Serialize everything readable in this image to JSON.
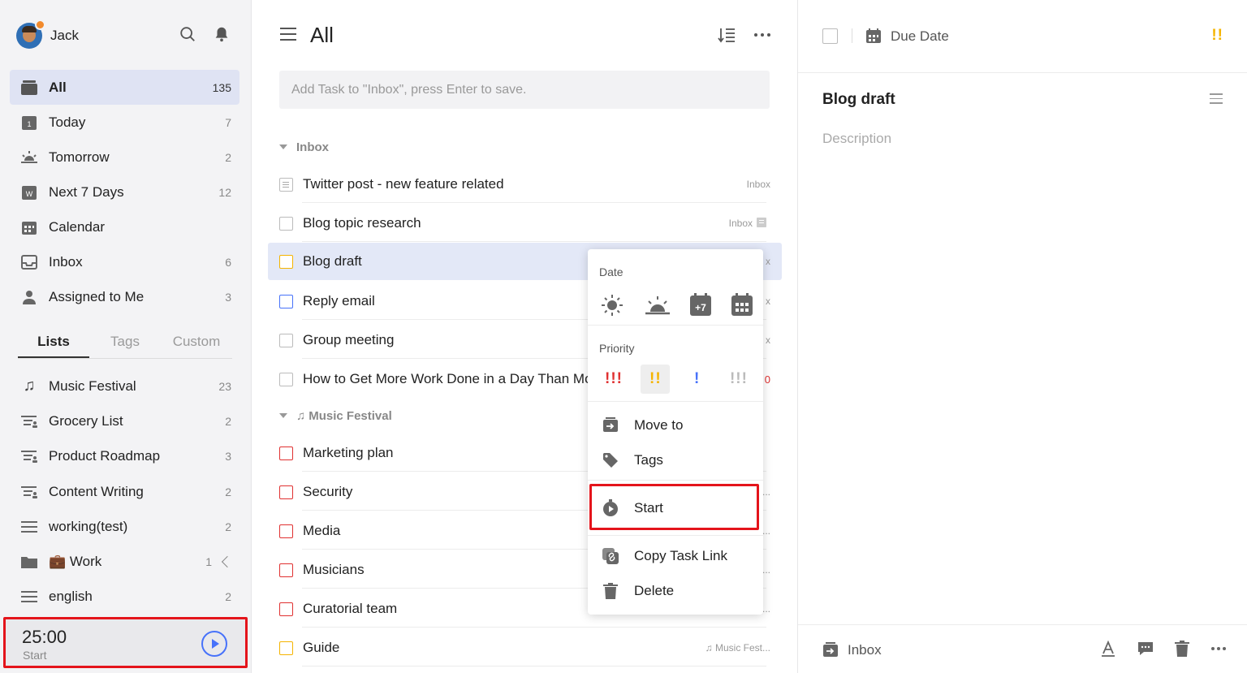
{
  "user": {
    "name": "Jack"
  },
  "nav": [
    {
      "label": "All",
      "count": "135",
      "icon": "inbox-stack-icon",
      "active": true
    },
    {
      "label": "Today",
      "count": "7",
      "icon": "calendar-day-icon"
    },
    {
      "label": "Tomorrow",
      "count": "2",
      "icon": "sunrise-icon"
    },
    {
      "label": "Next 7 Days",
      "count": "12",
      "icon": "calendar-week-icon"
    },
    {
      "label": "Calendar",
      "count": "",
      "icon": "calendar-icon"
    },
    {
      "label": "Inbox",
      "count": "6",
      "icon": "inbox-icon"
    },
    {
      "label": "Assigned to Me",
      "count": "3",
      "icon": "person-icon"
    }
  ],
  "tabs": {
    "lists": "Lists",
    "tags": "Tags",
    "custom": "Custom"
  },
  "lists": [
    {
      "label": "Music Festival",
      "count": "23",
      "icon": "music-note-icon"
    },
    {
      "label": "Grocery List",
      "count": "2",
      "icon": "shared-list-icon"
    },
    {
      "label": "Product Roadmap",
      "count": "3",
      "icon": "shared-list-icon"
    },
    {
      "label": "Content Writing",
      "count": "2",
      "icon": "shared-list-icon"
    },
    {
      "label": "working(test)",
      "count": "2",
      "icon": "list-icon"
    },
    {
      "label": "💼 Work",
      "count": "1",
      "icon": "folder-icon"
    },
    {
      "label": "english",
      "count": "2",
      "icon": "list-icon"
    }
  ],
  "timer": {
    "time": "25:00",
    "label": "Start"
  },
  "main": {
    "title": "All",
    "add_placeholder": "Add Task to \"Inbox\", press Enter to save.",
    "section_inbox": "Inbox",
    "section_music": "Music Festival",
    "tasks": [
      {
        "title": "Twitter post - new feature related",
        "tag": "Inbox"
      },
      {
        "title": "Blog topic research",
        "tag": "Inbox"
      },
      {
        "title": "Blog draft",
        "tag": "x"
      },
      {
        "title": "Reply email",
        "tag": "x"
      },
      {
        "title": "Group meeting",
        "tag": "x"
      },
      {
        "title": "How to Get More Work Done in a Day Than Mo",
        "tag": "0"
      },
      {
        "title": "Marketing plan",
        "tag": ""
      },
      {
        "title": "Security",
        "tag": "..."
      },
      {
        "title": "Media",
        "tag": "..."
      },
      {
        "title": "Musicians",
        "tag": "..."
      },
      {
        "title": "Curatorial team",
        "tag": "..."
      },
      {
        "title": "Guide",
        "tag": "♫ Music Fest..."
      }
    ]
  },
  "menu": {
    "date_label": "Date",
    "priority_label": "Priority",
    "priority_high": "!!!",
    "priority_medium": "!!",
    "priority_low": "!",
    "priority_none": "!!!",
    "move_to": "Move to",
    "tags": "Tags",
    "start": "Start",
    "copy_link": "Copy Task Link",
    "delete": "Delete"
  },
  "detail": {
    "due_date": "Due Date",
    "priority_flag": "!!",
    "title": "Blog draft",
    "description_placeholder": "Description",
    "project": "Inbox"
  },
  "colors": {
    "accent": "#4772fa",
    "highlight_red": "#e4141b",
    "priority_high": "#e03131",
    "priority_medium": "#f5b400",
    "priority_low": "#4772fa"
  }
}
